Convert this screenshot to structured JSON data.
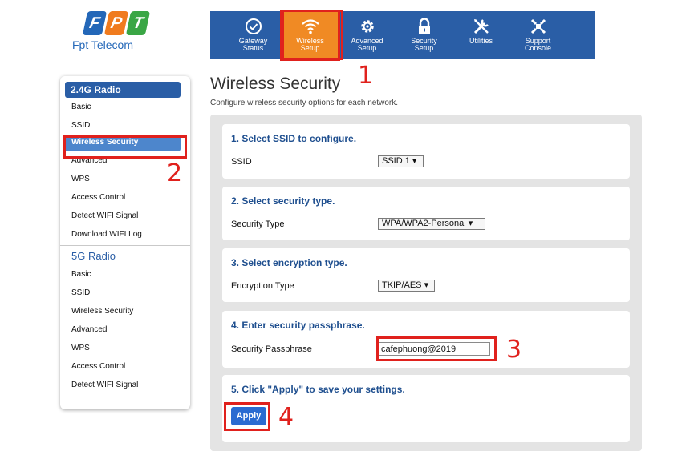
{
  "brand": {
    "logo_letters": [
      "F",
      "P",
      "T"
    ],
    "logo_text": "Fpt Telecom"
  },
  "nav": {
    "items": [
      {
        "label": "Gateway\nStatus",
        "icon": "check-circle-icon"
      },
      {
        "label": "Wireless\nSetup",
        "icon": "wifi-icon"
      },
      {
        "label": "Advanced\nSetup",
        "icon": "gear-icon"
      },
      {
        "label": "Security\nSetup",
        "icon": "lock-icon"
      },
      {
        "label": "Utilities",
        "icon": "tools-icon"
      },
      {
        "label": "Support\nConsole",
        "icon": "support-icon"
      }
    ],
    "active_index": 1,
    "colors": {
      "bar": "#2a5ea6",
      "active": "#f08a24",
      "highlight": "#e0211d"
    }
  },
  "callouts": [
    "1",
    "2",
    "3",
    "4"
  ],
  "sidebar": {
    "radio24": {
      "header": "2.4G Radio",
      "items": [
        "Basic",
        "SSID",
        "Wireless Security",
        "Advanced",
        "WPS",
        "Access Control",
        "Detect WIFI Signal",
        "Download WIFI Log"
      ],
      "active_index": 2
    },
    "radio5": {
      "header": "5G Radio",
      "items": [
        "Basic",
        "SSID",
        "Wireless Security",
        "Advanced",
        "WPS",
        "Access Control",
        "Detect WIFI Signal"
      ]
    }
  },
  "main": {
    "title": "Wireless Security",
    "subtitle": "Configure wireless security options for each network.",
    "step1": {
      "title": "1. Select SSID to configure.",
      "label": "SSID",
      "value": "SSID 1 ▾"
    },
    "step2": {
      "title": "2. Select security type.",
      "label": "Security Type",
      "value": "WPA/WPA2-Personal  ▾"
    },
    "step3": {
      "title": "3. Select encryption type.",
      "label": "Encryption Type",
      "value": "TKIP/AES ▾"
    },
    "step4": {
      "title": "4. Enter security passphrase.",
      "label": "Security Passphrase",
      "value": "cafephuong@2019"
    },
    "step5": {
      "title": "5. Click \"Apply\" to save your settings.",
      "button": "Apply"
    }
  }
}
